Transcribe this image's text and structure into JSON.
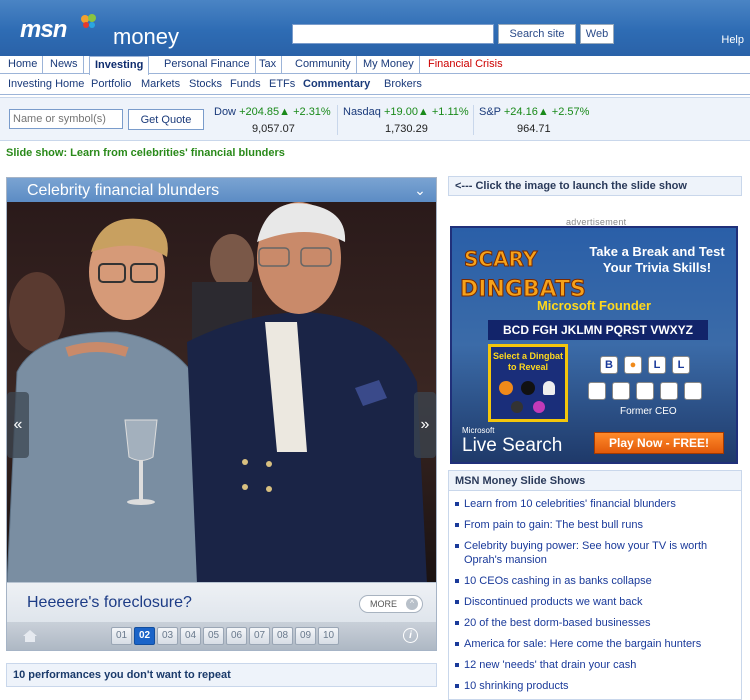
{
  "header": {
    "logo": "msn",
    "product": "money",
    "search_placeholder": "",
    "search_site_label": "Search site",
    "web_label": "Web",
    "help_label": "Help"
  },
  "nav": {
    "tabs": [
      {
        "label": "Home"
      },
      {
        "label": "News"
      },
      {
        "label": "Investing"
      },
      {
        "label": "Personal Finance"
      },
      {
        "label": "Tax"
      },
      {
        "label": "Community"
      },
      {
        "label": "My Money"
      },
      {
        "label": "Financial Crisis"
      }
    ],
    "subtabs": [
      {
        "label": "Investing Home"
      },
      {
        "label": "Portfolio"
      },
      {
        "label": "Markets"
      },
      {
        "label": "Stocks"
      },
      {
        "label": "Funds"
      },
      {
        "label": "ETFs"
      },
      {
        "label": "Commentary"
      },
      {
        "label": "Brokers"
      }
    ]
  },
  "quote": {
    "input_placeholder": "Name or symbol(s)",
    "button_label": "Get Quote",
    "indexes": [
      {
        "name": "Dow",
        "change": "+204.85▲ +2.31%",
        "value": "9,057.07"
      },
      {
        "name": "Nasdaq",
        "change": "+19.00▲ +1.11%",
        "value": "1,730.29"
      },
      {
        "name": "S&P",
        "change": "+24.16▲ +2.57%",
        "value": "964.71"
      }
    ]
  },
  "page": {
    "headline": "Slide show: Learn from celebrities' financial blunders"
  },
  "slideshow": {
    "title": "Celebrity financial blunders",
    "caption": "Heeeere's foreclosure?",
    "more_label": "MORE",
    "pages": [
      "01",
      "02",
      "03",
      "04",
      "05",
      "06",
      "07",
      "08",
      "09",
      "10"
    ],
    "current_page": "02",
    "prev_label": "«",
    "next_label": "»"
  },
  "below": {
    "performances": "10 performances you don't want to repeat"
  },
  "sidebar": {
    "launch_hint": "<--- Click the image to launch the slide show",
    "ad_label": "advertisement",
    "ad": {
      "brand": "SCARY DINGBATS",
      "tagline": "Take a Break and Test Your Trivia Skills!",
      "question": "Microsoft Founder",
      "letters": "BCD  FGH  JKLMN  PQRST  VWXYZ",
      "reveal": "Select a Dingbat to Reveal",
      "former": "Former CEO",
      "microsoft": "Microsoft",
      "live_search": "Live Search",
      "play": "Play Now - FREE!"
    },
    "slideshows": {
      "heading": "MSN Money Slide Shows",
      "items": [
        "Learn from 10 celebrities' financial blunders",
        "From pain to gain: The best bull runs",
        "Celebrity buying power: See how your TV is worth Oprah's mansion",
        "10 CEOs cashing in as banks collapse",
        "Discontinued products we want back",
        "20 of the best dorm-based businesses",
        "America for sale: Here come the bargain hunters",
        "12 new 'needs' that drain your cash",
        "10 shrinking products"
      ]
    }
  }
}
